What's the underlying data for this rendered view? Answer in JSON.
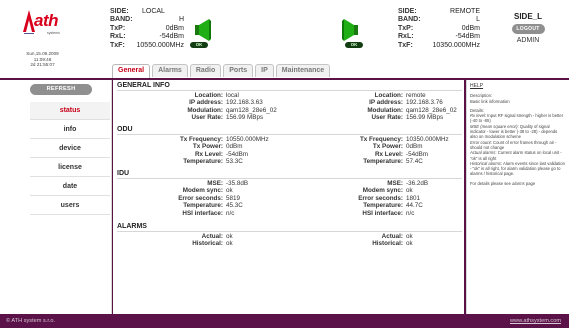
{
  "header": {
    "logo": {
      "brand": "ath",
      "sub": "systems"
    },
    "clock": {
      "date": "Sun,15.09.2009",
      "time": "11:09:48",
      "uptime": "2d 21:55:07"
    },
    "local": {
      "side_label": "SIDE:",
      "side_value": "LOCAL",
      "band_label": "BAND:",
      "band_value": "H",
      "txp_label": "TxP:",
      "txp_value": "0dBm",
      "rxl_label": "RxL:",
      "rxl_value": "-54dBm",
      "txf_label": "TxF:",
      "txf_value": "10550.000MHz",
      "status": "OK"
    },
    "remote": {
      "side_label": "SIDE:",
      "side_value": "REMOTE",
      "band_label": "BAND:",
      "band_value": "L",
      "txp_label": "TxP:",
      "txp_value": "0dBm",
      "rxl_label": "RxL:",
      "rxl_value": "-54dBm",
      "txf_label": "TxF:",
      "txf_value": "10350.000MHz",
      "status": "OK"
    },
    "side_box": {
      "side": "SIDE_L",
      "logout": "LOGOUT",
      "user": "ADMIN"
    },
    "tabs": [
      {
        "label": "General",
        "active": true
      },
      {
        "label": "Alarms",
        "active": false
      },
      {
        "label": "Radio",
        "active": false
      },
      {
        "label": "Ports",
        "active": false
      },
      {
        "label": "IP",
        "active": false
      },
      {
        "label": "Maintenance",
        "active": false
      }
    ]
  },
  "sidebar": {
    "refresh": "REFRESH",
    "items": [
      {
        "label": "status",
        "active": true
      },
      {
        "label": "info",
        "active": false
      },
      {
        "label": "device",
        "active": false
      },
      {
        "label": "license",
        "active": false
      },
      {
        "label": "date",
        "active": false
      },
      {
        "label": "users",
        "active": false
      }
    ]
  },
  "main": {
    "general": {
      "title": "GENERAL INFO",
      "rows": [
        {
          "lk": "Location:",
          "lv": "local",
          "rk": "Location:",
          "rv": "remote"
        },
        {
          "lk": "IP address:",
          "lv": "192.168.3.63",
          "rk": "IP address:",
          "rv": "192.168.3.76"
        },
        {
          "lk": "Modulation:",
          "lv": "qam128_28e6_02",
          "rk": "Modulation:",
          "rv": "qam128_28e6_02"
        },
        {
          "lk": "User Rate:",
          "lv": "156.99 MBps",
          "rk": "User Rate:",
          "rv": "156.99 MBps"
        }
      ]
    },
    "odu": {
      "title": "ODU",
      "rows": [
        {
          "lk": "Tx Frequency:",
          "lv": "10550.000MHz",
          "rk": "Tx Frequency:",
          "rv": "10350.000MHz"
        },
        {
          "lk": "Tx Power:",
          "lv": "0dBm",
          "rk": "Tx Power:",
          "rv": "0dBm"
        },
        {
          "lk": "Rx Level:",
          "lv": "-54dBm",
          "rk": "Rx Level:",
          "rv": "-54dBm"
        },
        {
          "lk": "Temperature:",
          "lv": "53.3C",
          "rk": "Temperature:",
          "rv": "57.4C"
        }
      ]
    },
    "idu": {
      "title": "IDU",
      "rows": [
        {
          "lk": "MSE:",
          "lv": "-35.8dB",
          "rk": "MSE:",
          "rv": "-36.2dB"
        },
        {
          "lk": "Modem sync:",
          "lv": "ok",
          "rk": "Modem sync:",
          "rv": "ok"
        },
        {
          "lk": "Error seconds:",
          "lv": "5819",
          "rk": "Error seconds:",
          "rv": "1801"
        },
        {
          "lk": "Temperature:",
          "lv": "45.3C",
          "rk": "Temperature:",
          "rv": "44.7C"
        },
        {
          "lk": "HSI interface:",
          "lv": "n/c",
          "rk": "HSI interface:",
          "rv": "n/c"
        }
      ]
    },
    "alarms": {
      "title": "ALARMS",
      "rows": [
        {
          "lk": "Actual:",
          "lv": "ok",
          "rk": "Actual:",
          "rv": "ok"
        },
        {
          "lk": "Historical:",
          "lv": "ok",
          "rk": "Historical:",
          "rv": "ok"
        }
      ]
    }
  },
  "help": {
    "title": "HELP",
    "description_label": "Description:",
    "description": "Basic link information",
    "details_label": "Details:",
    "details": [
      {
        "term": "Rx level",
        "text": ": Input RF signal strength - higher is better (-40 to -85)"
      },
      {
        "term": "MSE (mean square error)",
        "text": ": Quality of signal indicator - lower is better (-38 to -28) - depends also on modulation scheme"
      },
      {
        "term": "Error count",
        "text": ": Count of error frames through air - should not change"
      },
      {
        "term": "Actual alarms",
        "text": ": Current alarm status on local unit - \"ok\" is all right"
      },
      {
        "term": "Historical alarms",
        "text": ": Alarm events since last validation - \"ok\" is all right, for alarm validation please go to alarms / historical page."
      }
    ],
    "footer_prefix": "For details please see ",
    "footer_link": "alarms",
    "footer_suffix": " page"
  },
  "footer": {
    "copyright": "© ATH system s.r.o.",
    "site": "www.athsystem.com"
  },
  "colors": {
    "brand": "#d8001c",
    "frame": "#5a1248",
    "active_tab": "#c70019",
    "ok_badge": "#123d12",
    "antenna": "#1fae14"
  },
  "icons": {
    "logo": "ath-logo-icon",
    "antenna": "green-antenna-icon"
  }
}
